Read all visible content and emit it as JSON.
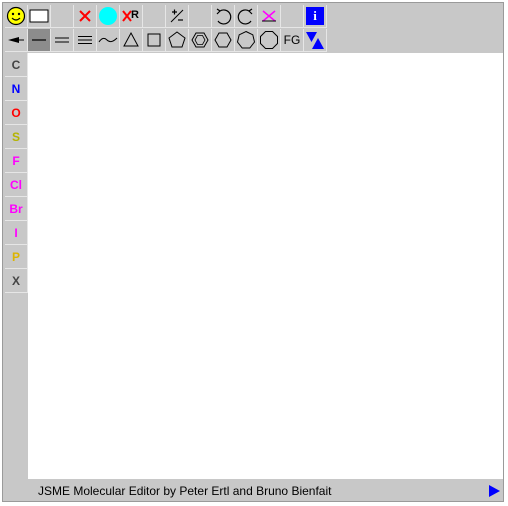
{
  "app": {
    "name": "JSME Molecular Editor"
  },
  "toolbar_top": [
    {
      "name": "smiley-icon"
    },
    {
      "name": "new-button-icon"
    },
    {
      "name": "blank-slot-1"
    },
    {
      "name": "delete-x-icon"
    },
    {
      "name": "mark-atom-icon"
    },
    {
      "name": "delete-r-group-icon",
      "text": "R"
    },
    {
      "name": "blank-slot-2"
    },
    {
      "name": "charge-icon",
      "text": "+/-"
    },
    {
      "name": "blank-slot-3"
    },
    {
      "name": "undo-icon"
    },
    {
      "name": "redo-icon"
    },
    {
      "name": "clear-icon"
    },
    {
      "name": "blank-slot-4"
    },
    {
      "name": "info-icon",
      "text": "i"
    }
  ],
  "toolbar_bottom": [
    {
      "name": "stereo-bond-icon"
    },
    {
      "name": "single-bond-icon",
      "selected": true
    },
    {
      "name": "double-bond-icon"
    },
    {
      "name": "triple-bond-icon"
    },
    {
      "name": "chain-icon"
    },
    {
      "name": "ring-3-icon"
    },
    {
      "name": "ring-4-icon"
    },
    {
      "name": "ring-5-icon"
    },
    {
      "name": "benzene-icon"
    },
    {
      "name": "ring-6-icon"
    },
    {
      "name": "ring-7-icon"
    },
    {
      "name": "ring-8-icon"
    },
    {
      "name": "functional-group-button",
      "text": "FG"
    },
    {
      "name": "up-down-icon"
    }
  ],
  "elements": [
    {
      "symbol": "C",
      "color": "#444444"
    },
    {
      "symbol": "N",
      "color": "#0000ff"
    },
    {
      "symbol": "O",
      "color": "#ff0000"
    },
    {
      "symbol": "S",
      "color": "#b4b400"
    },
    {
      "symbol": "F",
      "color": "#ff00ff"
    },
    {
      "symbol": "Cl",
      "color": "#ff00ff"
    },
    {
      "symbol": "Br",
      "color": "#ff00ff"
    },
    {
      "symbol": "I",
      "color": "#ff00ff"
    },
    {
      "symbol": "P",
      "color": "#dcb400"
    },
    {
      "symbol": "X",
      "color": "#444444"
    }
  ],
  "status": {
    "text": "JSME Molecular Editor by Peter Ertl and Bruno Bienfait"
  },
  "colors": {
    "accent": "#0000ff",
    "mark": "#00ffff",
    "delete": "#ff0000",
    "smiley": "#ffff00"
  }
}
